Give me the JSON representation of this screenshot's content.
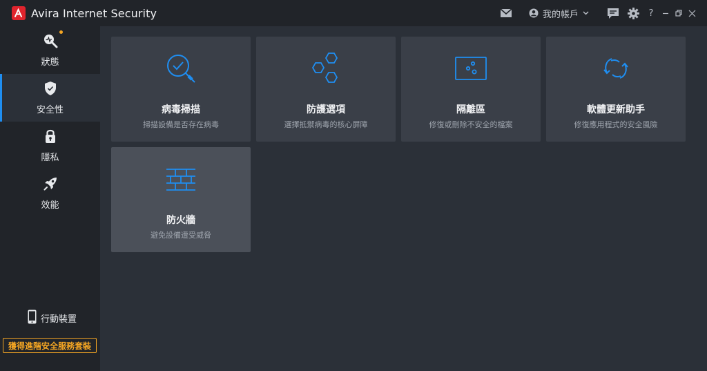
{
  "app": {
    "title": "Avira Internet Security"
  },
  "titlebar": {
    "account_label": "我的帳戶",
    "help_label": "?",
    "icons": [
      "mail-icon",
      "account-icon",
      "chevron-down-icon",
      "feedback-icon",
      "gear-icon",
      "help-icon",
      "minimize-icon",
      "restore-icon",
      "close-icon"
    ]
  },
  "sidebar": {
    "items": [
      {
        "label": "狀態",
        "icon": "status-icon"
      },
      {
        "label": "安全性",
        "icon": "shield-icon",
        "active": true
      },
      {
        "label": "隱私",
        "icon": "lock-icon"
      },
      {
        "label": "效能",
        "icon": "rocket-icon"
      }
    ],
    "mobile_label": "行動裝置",
    "upgrade_label": "獲得進階安全服務套裝"
  },
  "cards": [
    {
      "title": "病毒掃描",
      "desc": "掃描設備是否存在病毒",
      "icon": "scan-icon"
    },
    {
      "title": "防護選項",
      "desc": "選擇抵禦病毒的核心屏障",
      "icon": "hexagon-icon"
    },
    {
      "title": "隔離區",
      "desc": "修復或刪除不安全的檔案",
      "icon": "quarantine-icon"
    },
    {
      "title": "軟體更新助手",
      "desc": "修復應用程式的安全風險",
      "icon": "update-icon"
    },
    {
      "title": "防火牆",
      "desc": "避免設備遭受威脅",
      "icon": "firewall-icon"
    }
  ],
  "colors": {
    "accent": "#1f8ef1",
    "brand": "#e0242d",
    "upgrade": "#f5a623"
  }
}
